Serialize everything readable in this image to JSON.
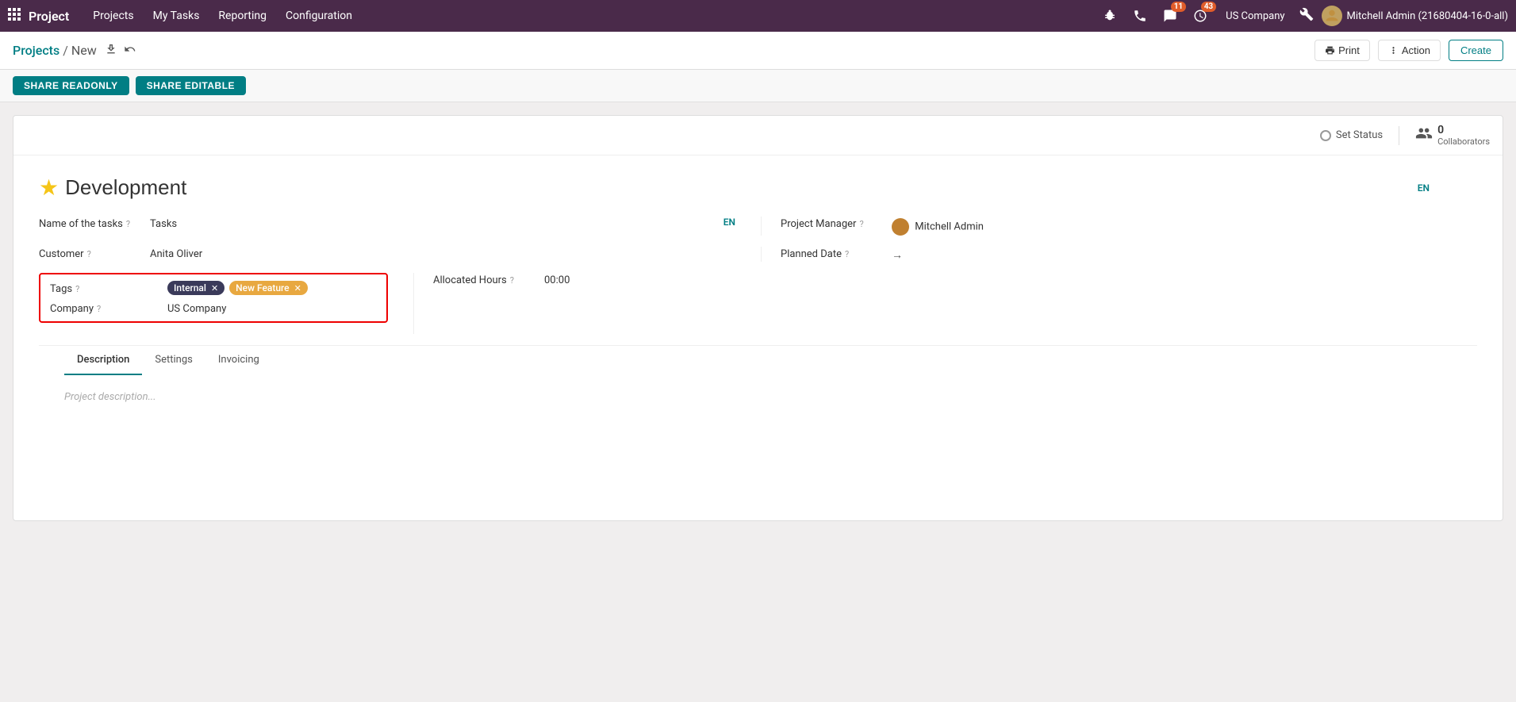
{
  "app": {
    "name": "Project",
    "grid_icon": "⊞"
  },
  "nav": {
    "items": [
      {
        "id": "projects",
        "label": "Projects"
      },
      {
        "id": "my-tasks",
        "label": "My Tasks"
      },
      {
        "id": "reporting",
        "label": "Reporting"
      },
      {
        "id": "configuration",
        "label": "Configuration"
      }
    ]
  },
  "top_icons": {
    "bug_icon": "🐞",
    "phone_icon": "📞",
    "chat_label": "11",
    "clock_label": "43",
    "company": "US Company",
    "wrench": "🔧",
    "user_name": "Mitchell Admin (21680404-16-0-all)"
  },
  "breadcrumb": {
    "parent": "Projects",
    "separator": "/",
    "current": "New",
    "upload_icon": "☁",
    "undo_icon": "↩"
  },
  "toolbar": {
    "print_label": "Print",
    "action_label": "Action",
    "create_label": "Create"
  },
  "share": {
    "readonly_label": "SHARE READONLY",
    "editable_label": "SHARE EDITABLE"
  },
  "form": {
    "status_label": "Set Status",
    "collaborators_count": "0",
    "collaborators_label": "Collaborators",
    "star_icon": "★",
    "project_title": "Development",
    "en_label": "EN",
    "fields": {
      "name_of_tasks_label": "Name of the tasks",
      "name_of_tasks_value": "Tasks",
      "customer_label": "Customer",
      "customer_value": "Anita Oliver",
      "tags_label": "Tags",
      "tags": [
        {
          "id": "internal",
          "label": "Internal",
          "style": "internal"
        },
        {
          "id": "new-feature",
          "label": "New Feature",
          "style": "new-feature"
        }
      ],
      "company_label": "Company",
      "company_value": "US Company",
      "project_manager_label": "Project Manager",
      "project_manager_value": "Mitchell Admin",
      "planned_date_label": "Planned Date",
      "planned_date_arrow": "→",
      "allocated_hours_label": "Allocated Hours",
      "allocated_hours_value": "00:00"
    },
    "tabs": [
      {
        "id": "description",
        "label": "Description",
        "active": true
      },
      {
        "id": "settings",
        "label": "Settings",
        "active": false
      },
      {
        "id": "invoicing",
        "label": "Invoicing",
        "active": false
      }
    ],
    "description_placeholder": "Project description..."
  }
}
